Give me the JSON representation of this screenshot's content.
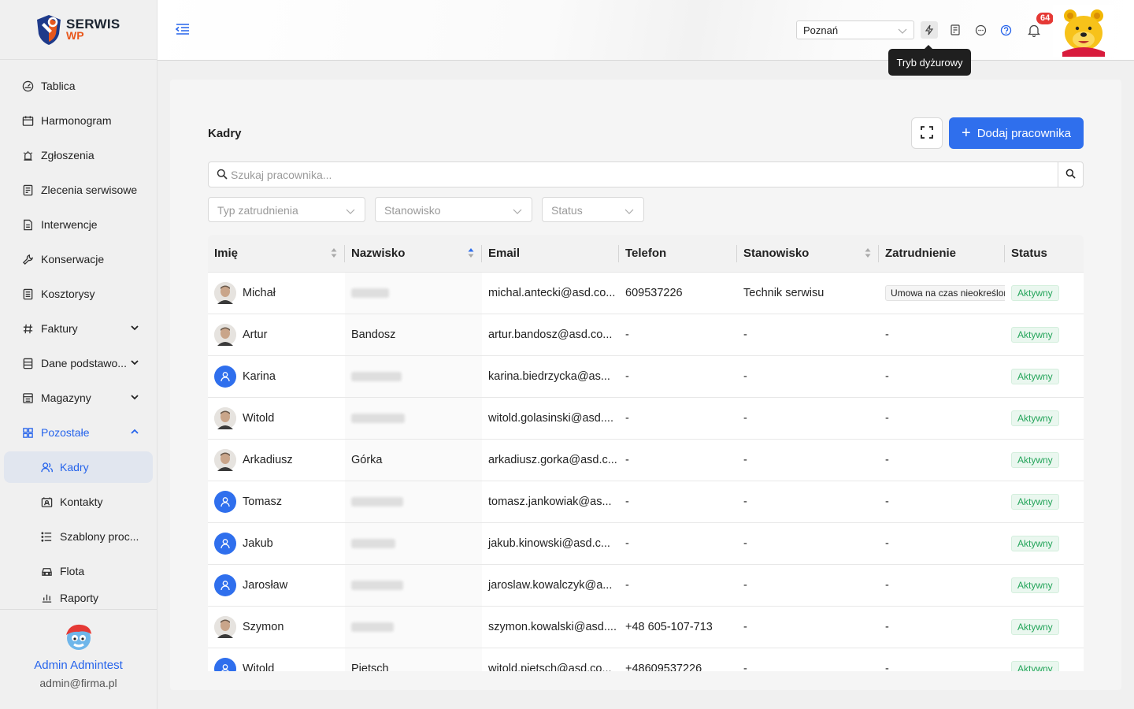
{
  "app": {
    "logo_line1": "SERWIS",
    "logo_line2": "WP"
  },
  "sidebar": {
    "items": [
      {
        "label": "Tablica",
        "icon": "dashboard-icon"
      },
      {
        "label": "Harmonogram",
        "icon": "calendar-icon"
      },
      {
        "label": "Zgłoszenia",
        "icon": "alarm-icon"
      },
      {
        "label": "Zlecenia serwisowe",
        "icon": "order-icon"
      },
      {
        "label": "Interwencje",
        "icon": "document-icon"
      },
      {
        "label": "Konserwacje",
        "icon": "wrench-icon"
      },
      {
        "label": "Kosztorysy",
        "icon": "estimate-icon"
      },
      {
        "label": "Faktury",
        "icon": "hash-icon"
      },
      {
        "label": "Dane podstawo...",
        "icon": "database-icon"
      },
      {
        "label": "Magazyny",
        "icon": "warehouse-icon"
      },
      {
        "label": "Pozostałe",
        "icon": "grid-icon"
      }
    ],
    "subitems": [
      {
        "label": "Kadry",
        "icon": "people-icon"
      },
      {
        "label": "Kontakty",
        "icon": "contact-icon"
      },
      {
        "label": "Szablony proc...",
        "icon": "list-icon"
      },
      {
        "label": "Flota",
        "icon": "car-icon"
      },
      {
        "label": "Raporty",
        "icon": "chart-icon"
      }
    ],
    "user": {
      "name": "Admin Admintest",
      "email": "admin@firma.pl"
    }
  },
  "topbar": {
    "location": "Poznań",
    "notification_count": "64",
    "tooltip": "Tryb dyżurowy"
  },
  "page": {
    "title": "Kadry",
    "add_button": "Dodaj pracownika",
    "search_placeholder": "Szukaj pracownika...",
    "filters": [
      "Typ zatrudnienia",
      "Stanowisko",
      "Status"
    ]
  },
  "table": {
    "headers": [
      "Imię",
      "Nazwisko",
      "Email",
      "Telefon",
      "Stanowisko",
      "Zatrudnienie",
      "Status"
    ],
    "rows": [
      {
        "first": "Michał",
        "last": "",
        "email": "michal.antecki@asd.co...",
        "phone": "609537226",
        "position": "Technik serwisu",
        "employment": "Umowa na czas nieokreślony",
        "status": "Aktywny",
        "avatar": "photo",
        "redacted": true
      },
      {
        "first": "Artur",
        "last": "Bandosz",
        "email": "artur.bandosz@asd.co...",
        "phone": "-",
        "position": "-",
        "employment": "-",
        "status": "Aktywny",
        "avatar": "photo",
        "redacted": false
      },
      {
        "first": "Karina",
        "last": "",
        "email": "karina.biedrzycka@as...",
        "phone": "-",
        "position": "-",
        "employment": "-",
        "status": "Aktywny",
        "avatar": "blue",
        "redacted": true
      },
      {
        "first": "Witold",
        "last": "",
        "email": "witold.golasinski@asd....",
        "phone": "-",
        "position": "-",
        "employment": "-",
        "status": "Aktywny",
        "avatar": "photo",
        "redacted": true
      },
      {
        "first": "Arkadiusz",
        "last": "Górka",
        "email": "arkadiusz.gorka@asd.c...",
        "phone": "-",
        "position": "-",
        "employment": "-",
        "status": "Aktywny",
        "avatar": "photo",
        "redacted": false
      },
      {
        "first": "Tomasz",
        "last": "",
        "email": "tomasz.jankowiak@as...",
        "phone": "-",
        "position": "-",
        "employment": "-",
        "status": "Aktywny",
        "avatar": "blue",
        "redacted": true
      },
      {
        "first": "Jakub",
        "last": "",
        "email": "jakub.kinowski@asd.c...",
        "phone": "-",
        "position": "-",
        "employment": "-",
        "status": "Aktywny",
        "avatar": "blue",
        "redacted": true
      },
      {
        "first": "Jarosław",
        "last": "",
        "email": "jaroslaw.kowalczyk@a...",
        "phone": "-",
        "position": "-",
        "employment": "-",
        "status": "Aktywny",
        "avatar": "blue",
        "redacted": true
      },
      {
        "first": "Szymon",
        "last": "",
        "email": "szymon.kowalski@asd....",
        "phone": "+48 605-107-713",
        "position": "-",
        "employment": "-",
        "status": "Aktywny",
        "avatar": "photo",
        "redacted": true
      },
      {
        "first": "Witold",
        "last": "Pietsch",
        "email": "witold.pietsch@asd.co...",
        "phone": "+48609537226",
        "position": "-",
        "employment": "-",
        "status": "Aktywny",
        "avatar": "blue",
        "redacted": false
      }
    ]
  },
  "colors": {
    "accent": "#2f6fed",
    "status_green": "#25a55b",
    "badge_red": "#e53935"
  }
}
